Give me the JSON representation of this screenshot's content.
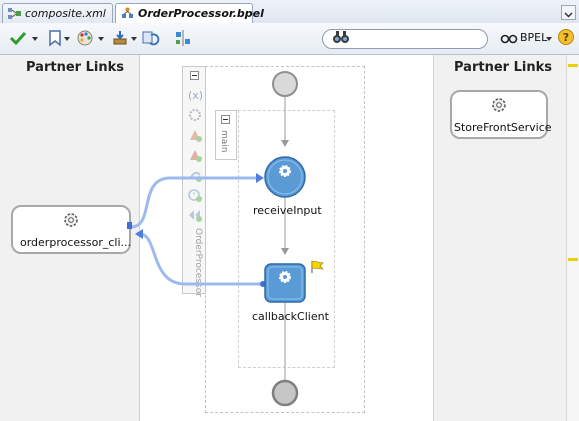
{
  "tabs": [
    {
      "label": "composite.xml",
      "active": false,
      "icon": "composite-icon"
    },
    {
      "label": "OrderProcessor.bpel",
      "active": true,
      "icon": "bpel-process-icon"
    }
  ],
  "toolbar": {
    "search_placeholder": "",
    "bpel_label": "BPEL",
    "help_label": "?"
  },
  "left_lane": {
    "heading": "Partner Links",
    "partner_link": {
      "label": "orderprocessor_cli...",
      "icon": "gear-service-icon"
    }
  },
  "right_lane": {
    "heading": "Partner Links",
    "partner_link": {
      "label": "StoreFrontService",
      "icon": "gear-service-icon"
    }
  },
  "process": {
    "main_label": "main",
    "scope_label": "OrderProcessor",
    "activities": [
      {
        "label": "receiveInput",
        "type": "receive"
      },
      {
        "label": "callbackClient",
        "type": "invoke"
      }
    ]
  },
  "colors": {
    "activity_blue": "#5a9bd6",
    "connector_blue": "#9cb9f0",
    "lane_gray": "#f1f1f1",
    "flag_yellow": "#f5d300"
  }
}
